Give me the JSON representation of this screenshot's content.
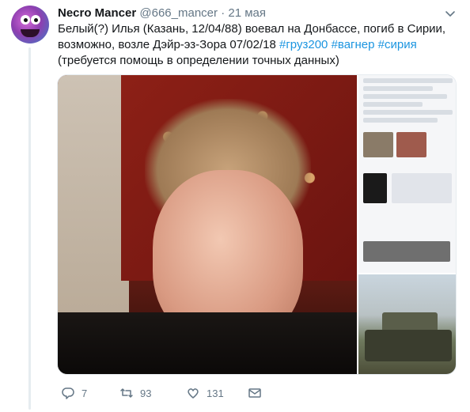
{
  "tweet": {
    "author_name": "Necro Mancer",
    "author_handle": "@666_mancer",
    "separator": "·",
    "date": "21 мая",
    "text_main": "Белый(?) Илья (Казань, 12/04/88) воевал на Донбассе, погиб в Сирии, возможно, возле Дэйр-эз-Зора 07/02/18",
    "hashtags": [
      "#груз200",
      "#вагнер",
      "#сирия"
    ],
    "text_tail": "(требуется помощь в определении точных данных)"
  },
  "actions": {
    "reply_count": "7",
    "retweet_count": "93",
    "like_count": "131"
  },
  "icons": {
    "reply": "reply-icon",
    "retweet": "retweet-icon",
    "like": "heart-icon",
    "dm": "envelope-icon",
    "more": "chevron-down-icon"
  },
  "colors": {
    "hashtag": "#1b95e0",
    "muted": "#657786",
    "thread_line": "#e6ecf0"
  }
}
